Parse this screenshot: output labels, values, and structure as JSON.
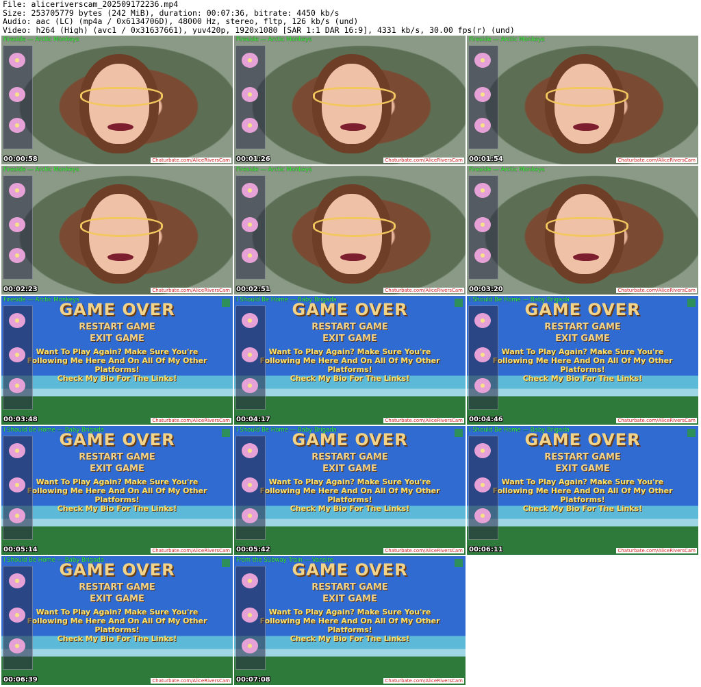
{
  "header": {
    "file": "File: aliceriverscam_202509172236.mp4",
    "size": "Size: 253705779 bytes (242 MiB), duration: 00:07:36, bitrate: 4450 kb/s",
    "audio": "Audio: aac (LC) (mp4a / 0x6134706D), 48000 Hz, stereo, fltp, 126 kb/s (und)",
    "video": "Video: h264 (High) (avc1 / 0x31637661), yuv420p, 1920x1080 [SAR 1:1 DAR 16:9], 4331 kb/s, 30.00 fps(r) (und)"
  },
  "watermark": "Chaturbate.com/AliceRiversCam",
  "game_over": {
    "title": "GAME OVER",
    "restart": "RESTART GAME",
    "exit": "EXIT GAME",
    "message": "Want To Play Again? Make Sure You're Following Me Here And On All Of My Other Platforms!",
    "bio": "Check My Bio For The Links!"
  },
  "thumbnails": [
    {
      "time": "00:00:58",
      "song": "Fireside — Arctic Monkeys",
      "kind": "cam"
    },
    {
      "time": "00:01:26",
      "song": "Fireside — Arctic Monkeys",
      "kind": "cam"
    },
    {
      "time": "00:01:54",
      "song": "Fireside — Arctic Monkeys",
      "kind": "cam"
    },
    {
      "time": "00:02:23",
      "song": "Fireside — Arctic Monkeys",
      "kind": "cam"
    },
    {
      "time": "00:02:51",
      "song": "Fireside — Arctic Monkeys",
      "kind": "cam"
    },
    {
      "time": "00:03:20",
      "song": "Fireside — Arctic Monkeys",
      "kind": "cam"
    },
    {
      "time": "00:03:48",
      "song": "Fireside — Arctic Monkeys",
      "kind": "game-over"
    },
    {
      "time": "00:04:17",
      "song": "I Should Be Home — Baby Brigada",
      "kind": "game-over"
    },
    {
      "time": "00:04:46",
      "song": "I Should Be Home — Baby Brigada",
      "kind": "game-over"
    },
    {
      "time": "00:05:14",
      "song": "I Should Be Home — Baby Brigada",
      "kind": "game-over"
    },
    {
      "time": "00:05:42",
      "song": "I Should Be Home — Baby Brigada",
      "kind": "game-over"
    },
    {
      "time": "00:06:11",
      "song": "I Should Be Home — Baby Brigada",
      "kind": "game-over"
    },
    {
      "time": "00:06:39",
      "song": "I Should Be Home — Baby Brigada",
      "kind": "game-over"
    },
    {
      "time": "00:07:08",
      "song": "From the Subway Train — Vansire",
      "kind": "game-over"
    }
  ]
}
